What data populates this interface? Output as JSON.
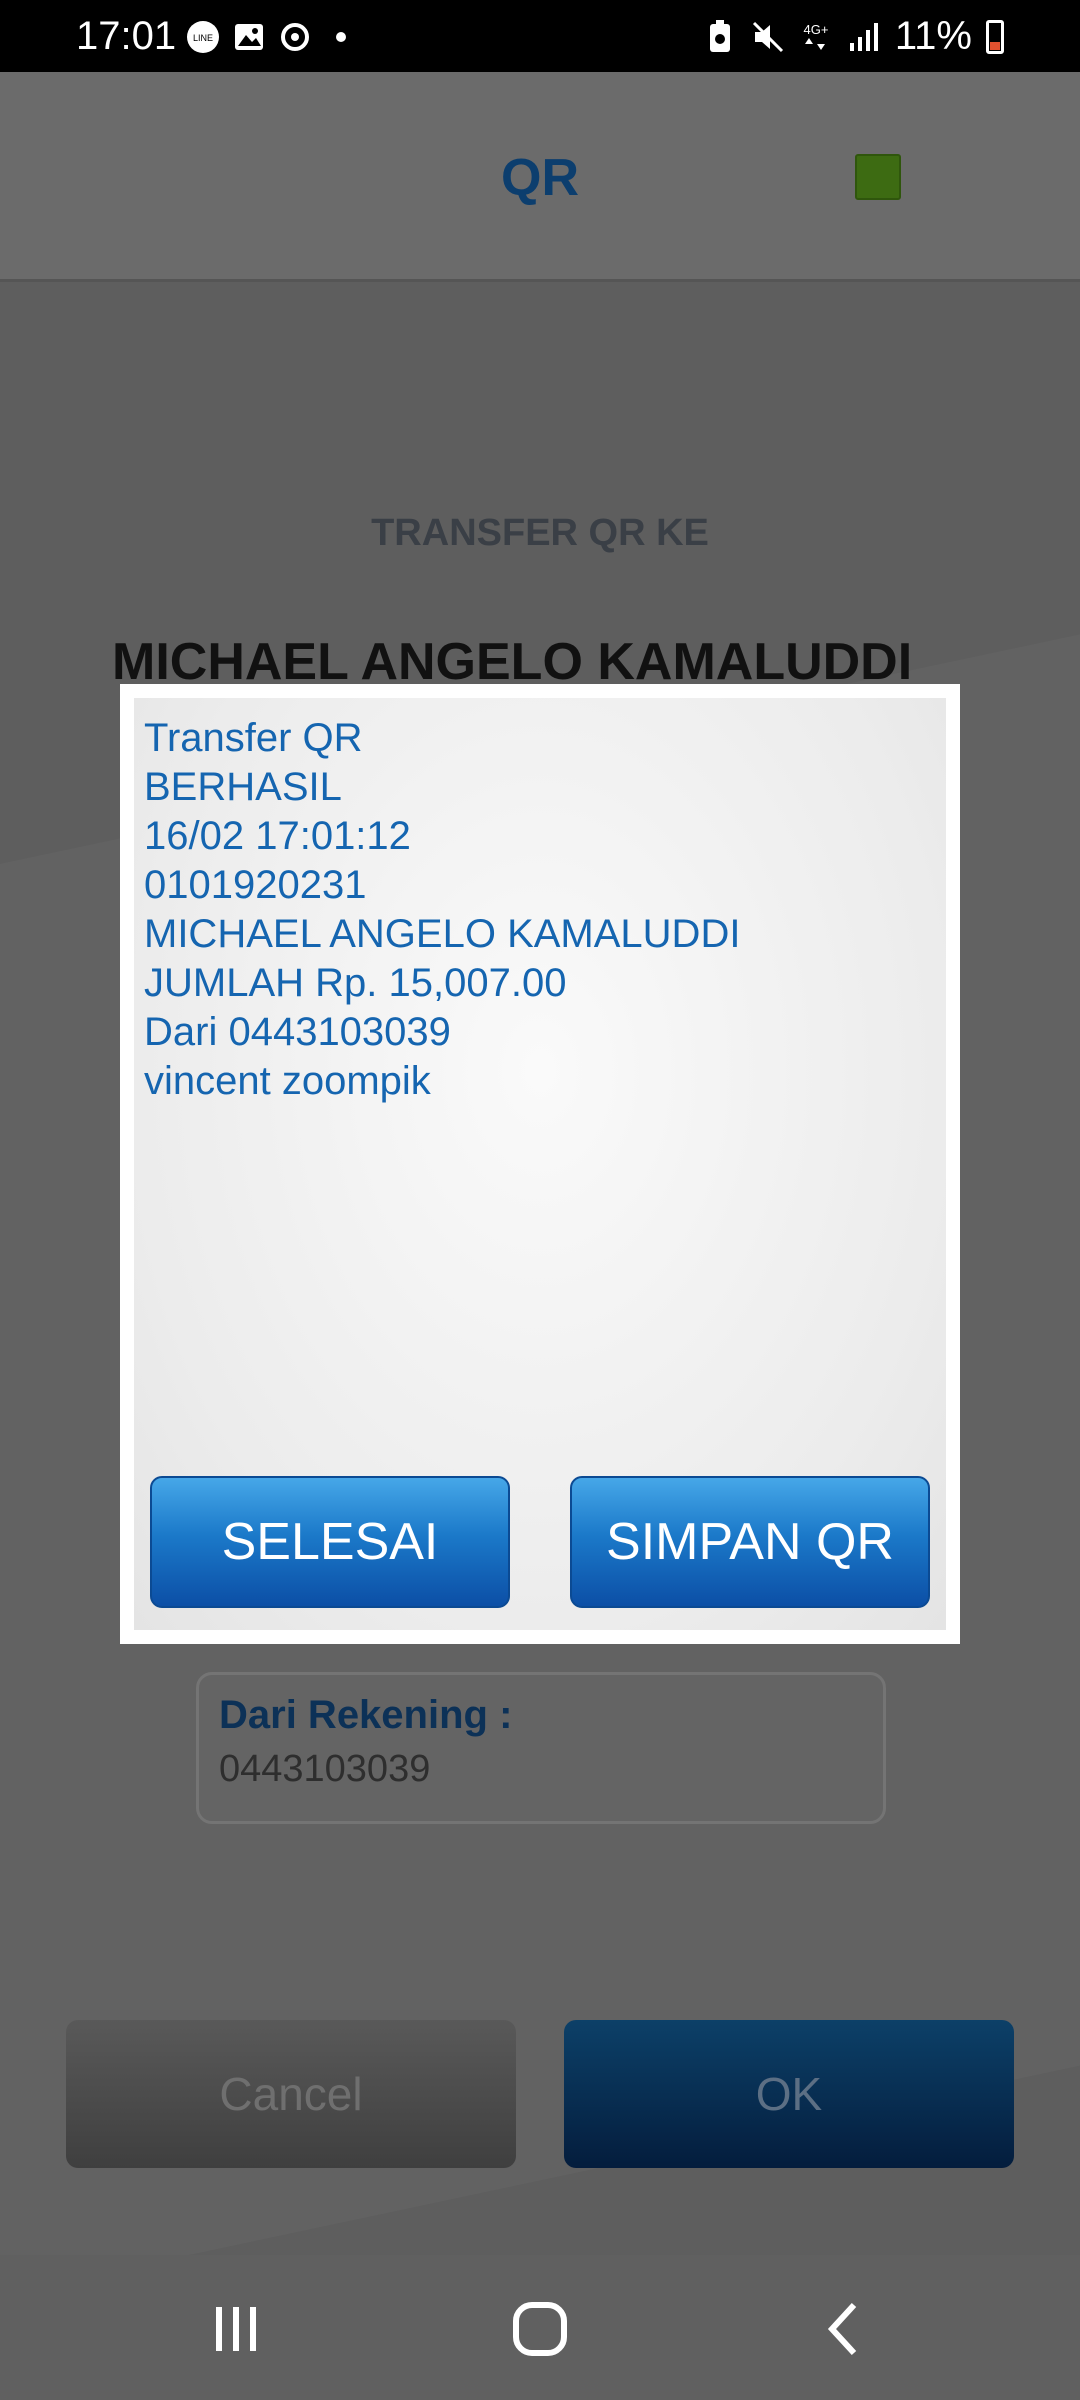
{
  "status_bar": {
    "time": "17:01",
    "icons_left": [
      "line-icon",
      "gallery-icon",
      "sync-icon",
      "dot-icon"
    ],
    "icons_right": [
      "battery-saver-icon",
      "mute-icon",
      "4g-icon",
      "signal-icon"
    ],
    "battery_percent": "11%"
  },
  "app_bar": {
    "title": "QR",
    "indicator_color": "#3d6b12"
  },
  "screen": {
    "transfer_label": "TRANSFER QR KE",
    "recipient_name": "MICHAEL ANGELO KAMALUDDI",
    "from_account_label": "Dari Rekening :",
    "from_account_value": "0443103039",
    "cancel_label": "Cancel",
    "ok_label": "OK"
  },
  "dialog": {
    "lines": [
      "Transfer QR",
      "BERHASIL",
      "16/02 17:01:12",
      "0101920231",
      "MICHAEL ANGELO KAMALUDDI",
      "JUMLAH Rp. 15,007.00",
      "Dari 0443103039",
      "vincent zoompik"
    ],
    "done_label": "SELESAI",
    "save_label": "SIMPAN QR"
  },
  "nav_bar": {
    "icons": [
      "recent-apps-icon",
      "home-icon",
      "back-icon"
    ]
  },
  "colors": {
    "accent_blue": "#1565b0",
    "button_blue": "#1b79c9"
  }
}
